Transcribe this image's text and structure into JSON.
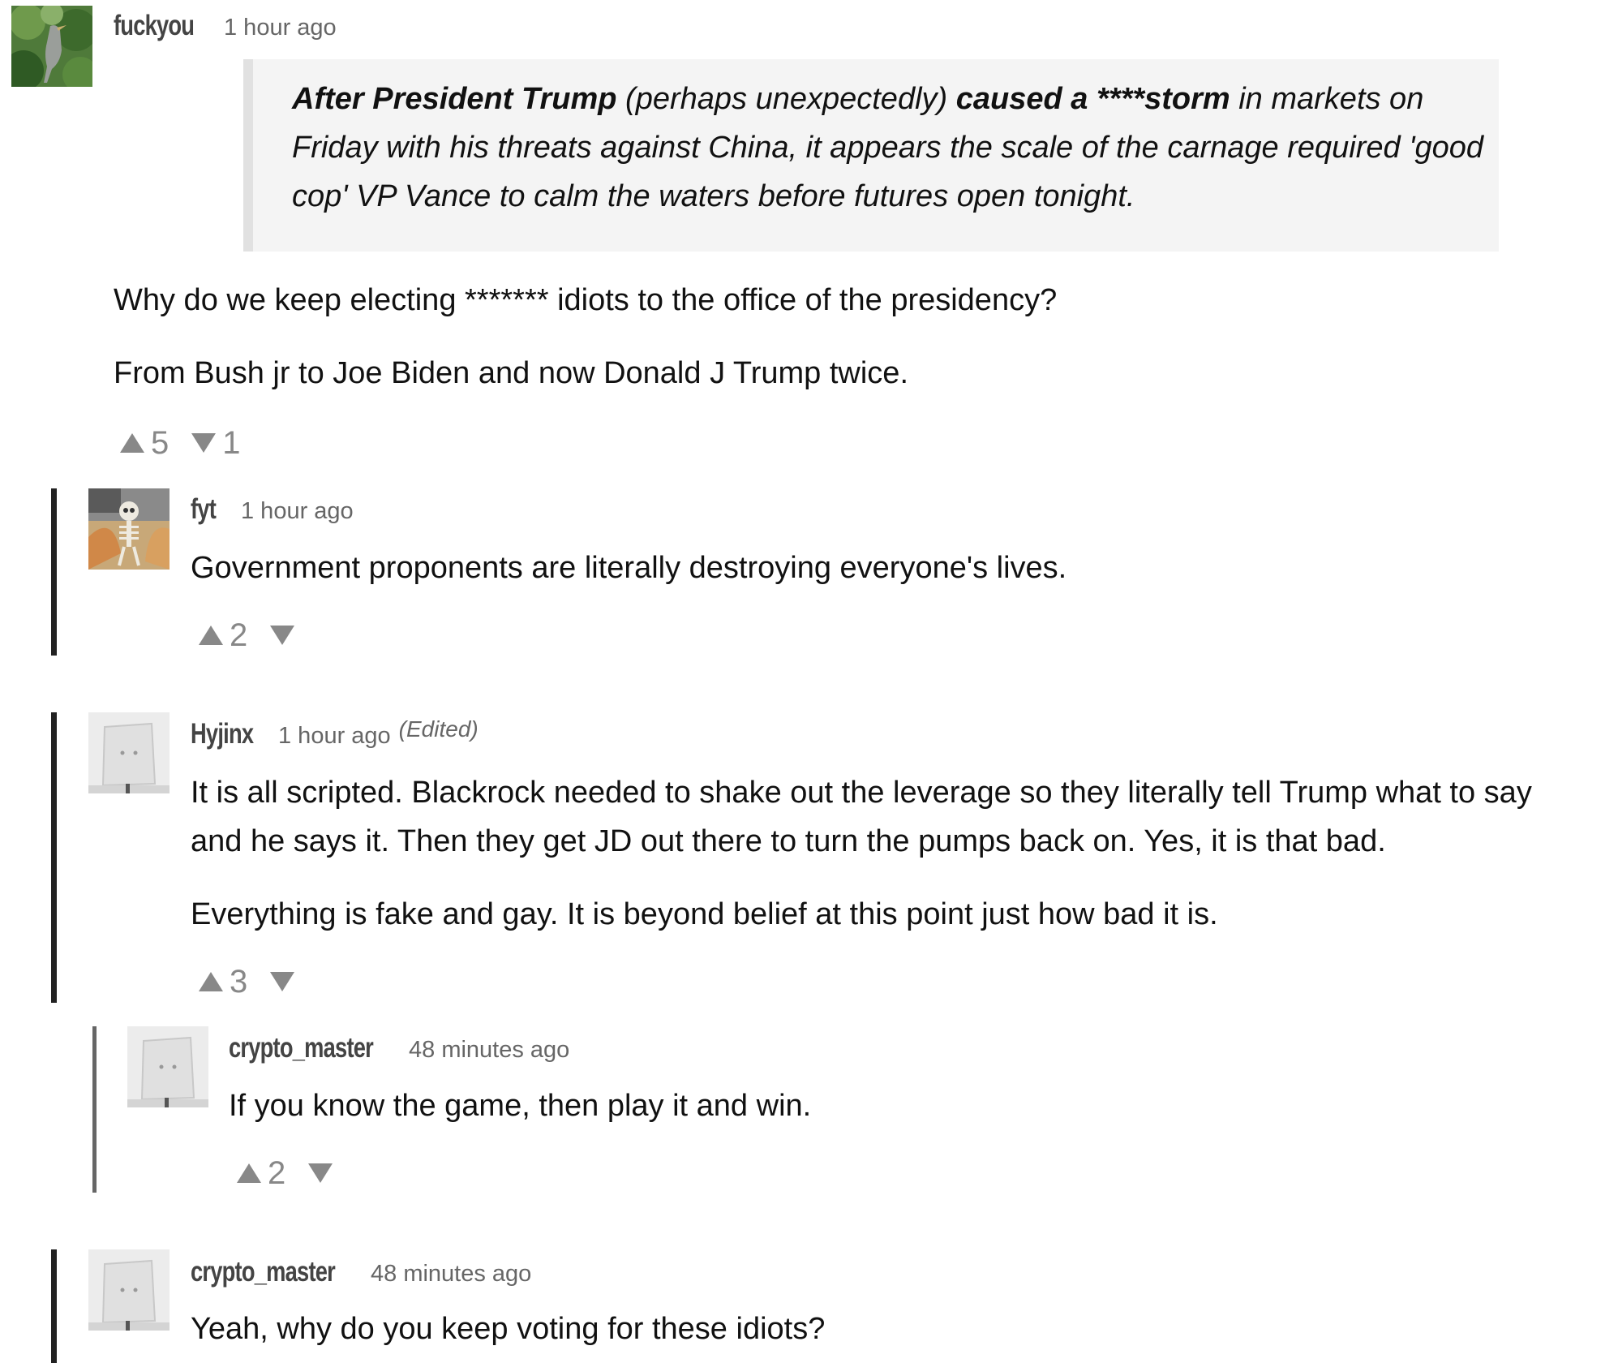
{
  "comments": [
    {
      "username": "fuckyou",
      "time": "1 hour ago",
      "quote": {
        "b1": "After President Trump",
        "t1": " (perhaps unexpectedly) ",
        "b2": "caused a ****storm",
        "t2": " in markets on Friday with his threats against China, it appears the scale of the carnage required 'good cop' VP Vance to calm the waters before futures open tonight."
      },
      "paragraphs": [
        "Why do we keep electing ******* idiots to the office of the presidency?",
        "From Bush jr to Joe Biden and now Donald J Trump twice."
      ],
      "upvotes": "5",
      "downvotes": "1",
      "avatar_icon": "bird-photo-icon"
    },
    {
      "username": "fyt",
      "time": "1 hour ago",
      "paragraphs": [
        "Government proponents are literally destroying everyone's lives."
      ],
      "upvotes": "2",
      "downvotes": "",
      "avatar_icon": "skeleton-photo-icon"
    },
    {
      "username": "Hyjinx",
      "time": "1 hour ago",
      "edited": "(Edited)",
      "paragraphs": [
        "It is all scripted. Blackrock needed to shake out the leverage so they literally tell Trump what to say",
        "and he says it. Then they get JD out there to turn the pumps back on. Yes, it is that bad.",
        "Everything is fake and gay. It is beyond belief at this point just how bad it is."
      ],
      "upvotes": "3",
      "downvotes": "",
      "avatar_icon": "default-avatar-icon"
    },
    {
      "username": "crypto_master",
      "time": "48 minutes ago",
      "paragraphs": [
        "If you know the game, then play it and win."
      ],
      "upvotes": "2",
      "downvotes": "",
      "avatar_icon": "default-avatar-icon"
    },
    {
      "username": "crypto_master",
      "time": "48 minutes ago",
      "paragraphs": [
        "Yeah, why do you keep voting for these idiots?"
      ],
      "avatar_icon": "default-avatar-icon"
    }
  ]
}
